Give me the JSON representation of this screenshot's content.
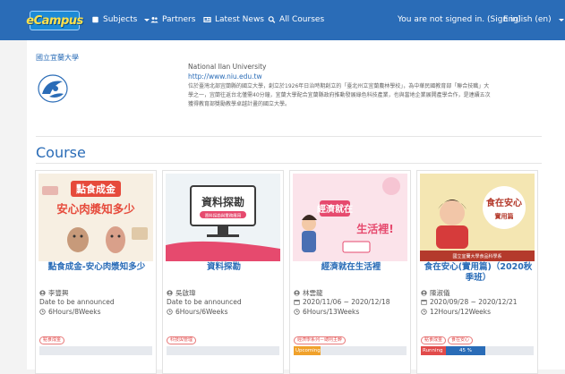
{
  "navbar": {
    "logo_text": "eCampus",
    "subjects": "Subjects",
    "partners": "Partners",
    "latest_news": "Latest News",
    "all_courses": "All Courses",
    "signin_status": "You are not signed in. (Sign in)",
    "language": "English (en)"
  },
  "university": {
    "name": "國立宜蘭大學",
    "english_name": "National Ilan University",
    "url": "http://www.niu.edu.tw",
    "description": "位於臺灣北部宜蘭縣的國立大學，創立於1926年日治時期創立的「臺北州立宜蘭農林學校」，為中華民國教育部「聯合技職」大學之一，宜蘭往返台北僅需40分鐘，宜蘭大學配合宜蘭縣政府推動發展綠色科技產業，也與當地企業展開產學合作，是連續五次獲得教育部獎勵教學卓越計畫的國立大學。"
  },
  "section_title": "Course",
  "courses": [
    {
      "title": "點食成金-安心肉漿知多少",
      "image_text": [
        "點食成金",
        "安心肉漿知多少"
      ],
      "teacher": "李豐興",
      "date": "Date to be announced",
      "hours": "6Hours/8Weeks",
      "tags": [
        "點食成金"
      ],
      "status": "",
      "progress_label": ""
    },
    {
      "title": "資料探勘",
      "image_text": [
        "資料探勘",
        "資料探勘與實務應用"
      ],
      "teacher": "吳啟瑋",
      "date": "Date to be announced",
      "hours": "6Hours/6Weeks",
      "tags": [
        "科技與管理"
      ],
      "status": "",
      "progress_label": ""
    },
    {
      "title": "經濟就在生活裡",
      "image_text": [
        "經濟就在",
        "生活裡!"
      ],
      "teacher": "林雲龍",
      "date": "2020/11/06 ~ 2020/12/18",
      "hours": "6Hours/13Weeks",
      "tags": [
        "經濟學系列－總則主幹"
      ],
      "status": "Upcoming",
      "progress_label": ""
    },
    {
      "title": "食在安心(實用篇)（2020秋季班）",
      "image_text": [
        "食在安心",
        "實用篇",
        "國立宜蘭大學食品科學系"
      ],
      "teacher": "陳淑儀",
      "date": "2020/09/28 ~ 2020/12/21",
      "hours": "12Hours/12Weeks",
      "tags": [
        "點食成金",
        "食在安心"
      ],
      "status": "Running",
      "progress_label": "45 %",
      "progress": 0.45
    }
  ],
  "colors": {
    "navbar": "#2a6cb7",
    "link": "#2a6cb7",
    "upcoming": "#f0a12b",
    "running": "#e14b4b"
  }
}
